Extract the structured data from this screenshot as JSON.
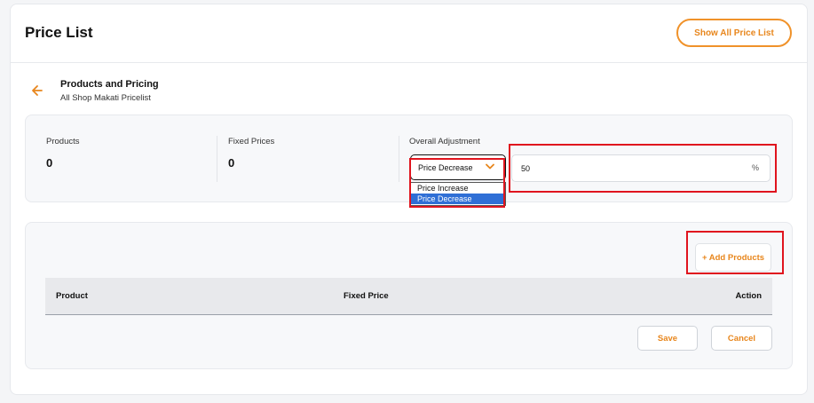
{
  "header": {
    "title": "Price List",
    "show_all_label": "Show All Price List"
  },
  "section": {
    "title": "Products and Pricing",
    "subtitle": "All Shop Makati Pricelist",
    "back_icon": "arrow-left-icon"
  },
  "stats": {
    "products_label": "Products",
    "products_value": "0",
    "fixed_prices_label": "Fixed Prices",
    "fixed_prices_value": "0",
    "adjustment_label": "Overall Adjustment"
  },
  "adjustment": {
    "selected": "Price Decrease",
    "options": [
      "Price Increase",
      "Price Decrease"
    ],
    "percent_value": "50",
    "percent_suffix": "%"
  },
  "products": {
    "add_label": "+ Add Products",
    "columns": [
      "Product",
      "Fixed Price",
      "Action"
    ],
    "save_label": "Save",
    "cancel_label": "Cancel"
  },
  "colors": {
    "accent": "#e8861c",
    "highlight": "#e0141e",
    "selected_option": "#2f6fd6"
  }
}
